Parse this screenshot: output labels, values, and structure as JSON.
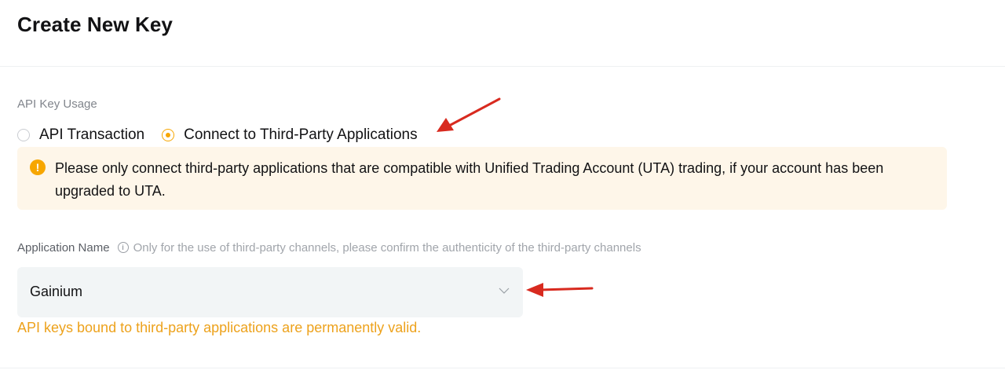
{
  "page": {
    "title": "Create New Key"
  },
  "api_key_usage": {
    "label": "API Key Usage",
    "options": [
      {
        "label": "API Transaction",
        "selected": false
      },
      {
        "label": "Connect to Third-Party Applications",
        "selected": true
      }
    ]
  },
  "warning": {
    "icon": "exclamation-icon",
    "text": "Please only connect third-party applications that are compatible with Unified Trading Account (UTA) trading, if your account has been upgraded to UTA."
  },
  "application_name": {
    "label": "Application Name",
    "hint": "Only for the use of third-party channels, please confirm the authenticity of the third-party channels",
    "selected_value": "Gainium",
    "note": "API keys bound to third-party applications are permanently valid."
  },
  "colors": {
    "accent": "#f7a600",
    "warning_bg": "#fef6e9",
    "note_text": "#eda21c",
    "annotation_arrow": "#d82a1f"
  }
}
